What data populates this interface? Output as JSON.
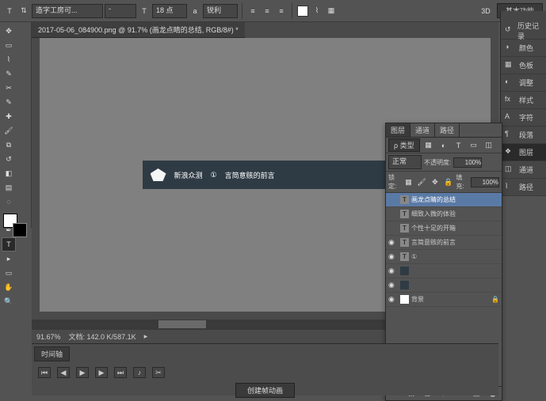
{
  "topbar": {
    "font_family": "造字工房可...",
    "font_size": "18 点",
    "aa": "锐利",
    "three_d": "3D",
    "basic": "基本功能"
  },
  "doctab": "2017-05-06_084900.png @ 91.7% (画龙点睛的总结, RGB/8#) *",
  "banner": {
    "brand": "新浪众测",
    "num": "①",
    "text": "言简意赅的前言"
  },
  "status": {
    "zoom": "91.67%",
    "docinfo": "文档: 142.0 K/587.1K"
  },
  "rail": [
    {
      "icon": "history",
      "label": "历史记录"
    },
    {
      "icon": "color",
      "label": "颜色"
    },
    {
      "icon": "swatch",
      "label": "色板"
    },
    {
      "icon": "adjust",
      "label": "调整"
    },
    {
      "icon": "style",
      "label": "样式"
    },
    {
      "icon": "char",
      "label": "字符"
    },
    {
      "icon": "para",
      "label": "段落"
    },
    {
      "icon": "layers",
      "label": "图层"
    },
    {
      "icon": "channel",
      "label": "通道"
    },
    {
      "icon": "path",
      "label": "路径"
    }
  ],
  "layers_panel": {
    "tabs": [
      "图层",
      "通道",
      "路径"
    ],
    "search": "ρ 类型",
    "blend": "正常",
    "opacity_label": "不透明度:",
    "opacity": "100%",
    "fill_label": "填充:",
    "fill": "100%",
    "lock": "锁定:",
    "rows": [
      {
        "vis": false,
        "type": "T",
        "name": "画龙点睛的总结",
        "sel": true
      },
      {
        "vis": false,
        "type": "T",
        "name": "细致入微的体验"
      },
      {
        "vis": false,
        "type": "T",
        "name": "个性十足的开箱"
      },
      {
        "vis": true,
        "type": "T",
        "name": "言简意赅的前言"
      },
      {
        "vis": true,
        "type": "T",
        "name": "①"
      },
      {
        "vis": true,
        "type": "-",
        "name": ""
      },
      {
        "vis": true,
        "type": "-",
        "name": ""
      },
      {
        "vis": true,
        "type": "bg",
        "name": "     背景",
        "lock": true
      }
    ]
  },
  "timeline": {
    "tab": "时间轴",
    "create": "创建帧动画"
  }
}
